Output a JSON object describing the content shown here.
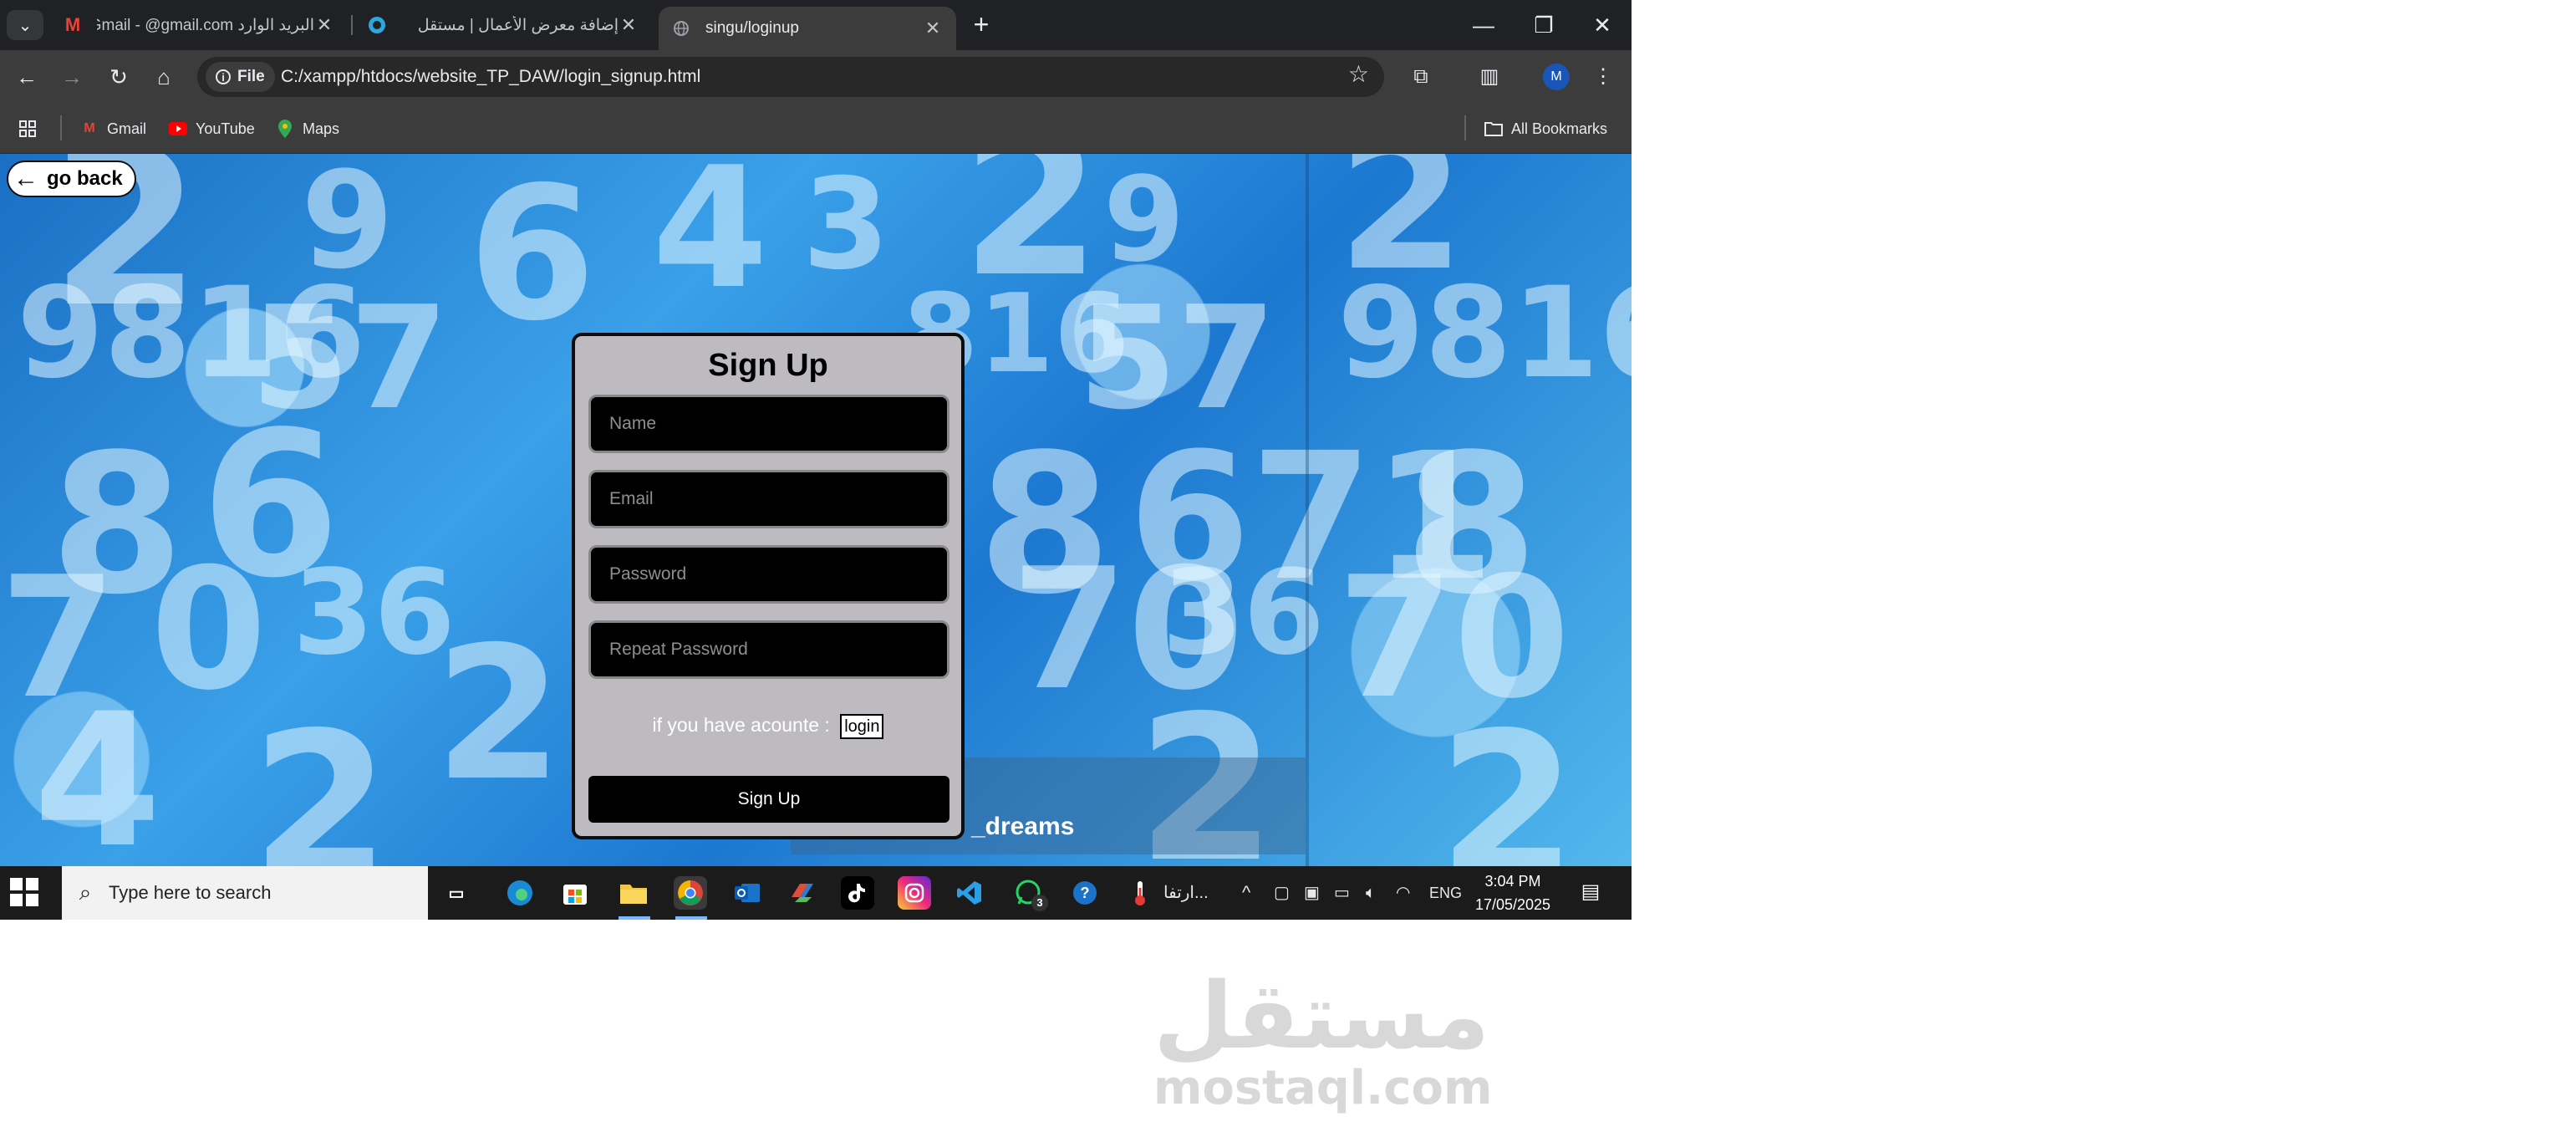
{
  "browser": {
    "tabs": [
      {
        "title": "البريد الوارد Gmail - @gmail.com",
        "icon": "gmail-icon"
      },
      {
        "title": "إضافة معرض الأعمال | مستقل",
        "icon": "mostaql-icon"
      },
      {
        "title": "singu/loginup",
        "icon": "globe-icon"
      }
    ],
    "active_tab": 2,
    "address": {
      "scheme_chip": "File",
      "url": "C:/xampp/htdocs/website_TP_DAW/login_signup.html"
    },
    "profile_initial": "M",
    "bookmarks": [
      {
        "label": "Gmail",
        "icon": "gmail-icon"
      },
      {
        "label": "YouTube",
        "icon": "youtube-icon"
      },
      {
        "label": "Maps",
        "icon": "maps-icon"
      }
    ],
    "all_bookmarks": "All Bookmarks"
  },
  "page": {
    "go_back": "go back",
    "form": {
      "title": "Sign Up",
      "name_placeholder": "Name",
      "email_placeholder": "Email",
      "password_placeholder": "Password",
      "repeat_password_placeholder": "Repeat Password",
      "have_account_text": "if you have acounte :",
      "login_link": "login",
      "submit_label": "Sign Up"
    },
    "background_caption": "_dreams"
  },
  "taskbar": {
    "search_placeholder": "Type here to search",
    "whatsapp_badge": "3",
    "weather_text": "ارتفا...",
    "language": "ENG",
    "time": "3:04 PM",
    "date": "17/05/2025"
  },
  "watermark": {
    "arabic": "مستقل",
    "latin": "mostaql.com"
  }
}
